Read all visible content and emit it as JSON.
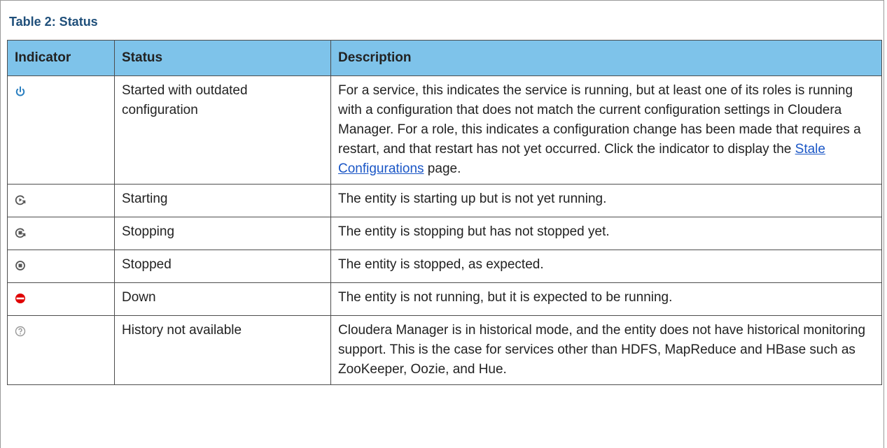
{
  "caption": "Table 2: Status",
  "headers": {
    "indicator": "Indicator",
    "status": "Status",
    "description": "Description"
  },
  "rows": [
    {
      "icon": "power-icon",
      "status": "Started with outdated configuration",
      "description_before": "For a service, this indicates the service is running, but at least one of its roles is running with a configuration that does not match the current configuration settings in Cloudera Manager. For a role, this indicates a configuration change has been made that requires a restart, and that restart has not yet occurred. Click the indicator to display the ",
      "link": "Stale Configurations",
      "description_after": " page."
    },
    {
      "icon": "starting-icon",
      "status": "Starting",
      "description": "The entity is starting up but is not yet running."
    },
    {
      "icon": "stopping-icon",
      "status": "Stopping",
      "description": "The entity is stopping but has not stopped yet."
    },
    {
      "icon": "stopped-icon",
      "status": "Stopped",
      "description": "The entity is stopped, as expected."
    },
    {
      "icon": "down-icon",
      "status": "Down",
      "description": "The entity is not running, but it is expected to be running."
    },
    {
      "icon": "history-unavailable-icon",
      "status": "History not available",
      "description": "Cloudera Manager is in historical mode, and the entity does not have historical monitoring support. This is the case for services other than HDFS, MapReduce and HBase such as ZooKeeper, Oozie, and Hue."
    }
  ],
  "colors": {
    "header_bg": "#7ec3ea",
    "caption": "#1f4f7a",
    "power_icon": "#2a7fc0",
    "down_icon": "#e00000",
    "link": "#1a56c6"
  }
}
